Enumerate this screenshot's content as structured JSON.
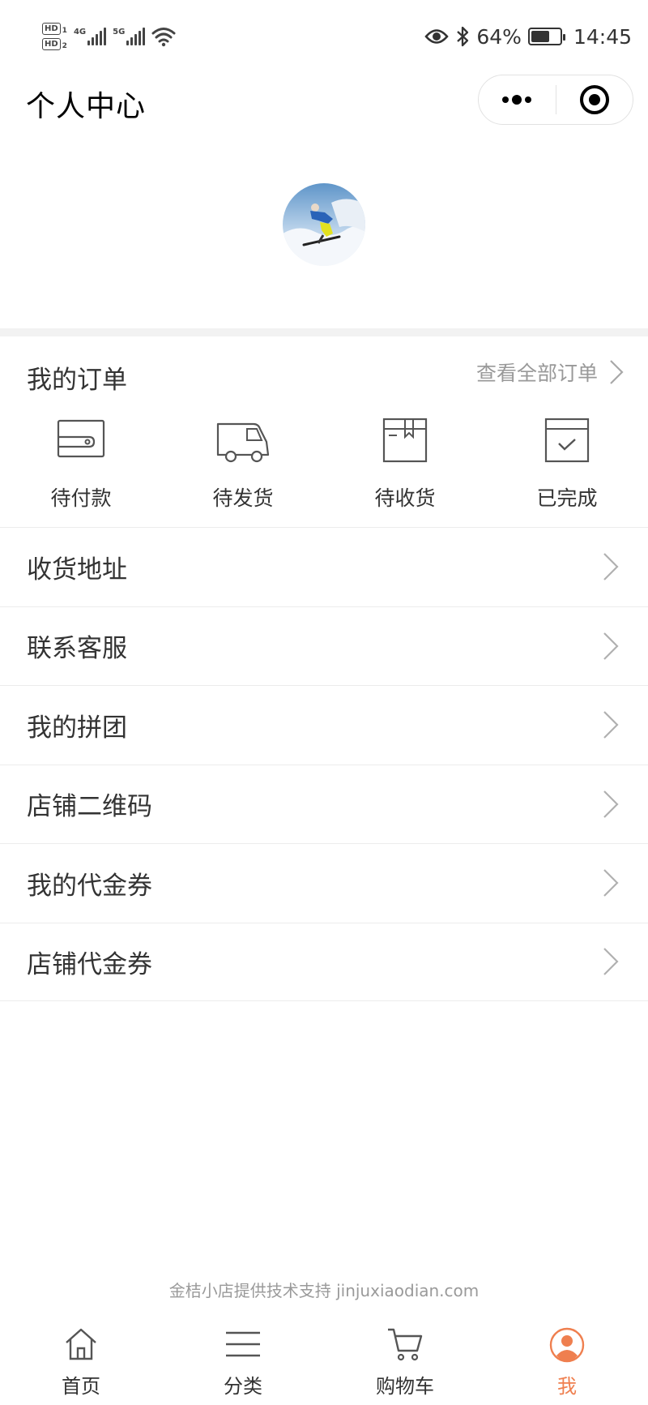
{
  "status_bar": {
    "hd1": "HD",
    "hd1_sub": "1",
    "hd2": "HD",
    "hd2_sub": "2",
    "net1": "4G",
    "net2": "5G",
    "battery_percent": "64%",
    "battery_level": 0.64,
    "time": "14:45",
    "icons": [
      "eye-icon",
      "bluetooth-icon",
      "wifi-icon",
      "battery-icon"
    ]
  },
  "nav": {
    "title": "个人中心",
    "more_icon": "more-dots-icon",
    "close_icon": "target-close-icon"
  },
  "orders": {
    "title": "我的订单",
    "view_all": "查看全部订单",
    "items": [
      {
        "label": "待付款",
        "icon": "wallet-icon"
      },
      {
        "label": "待发货",
        "icon": "truck-icon"
      },
      {
        "label": "待收货",
        "icon": "package-icon"
      },
      {
        "label": "已完成",
        "icon": "check-box-icon"
      }
    ]
  },
  "menu": {
    "items": [
      {
        "label": "收货地址"
      },
      {
        "label": "联系客服"
      },
      {
        "label": "我的拼团"
      },
      {
        "label": "店铺二维码"
      },
      {
        "label": "我的代金券"
      },
      {
        "label": "店铺代金券"
      }
    ]
  },
  "footer": {
    "note": "金桔小店提供技术支持 jinjuxiaodian.com"
  },
  "tabs": {
    "items": [
      {
        "label": "首页",
        "icon": "home-icon"
      },
      {
        "label": "分类",
        "icon": "menu-lines-icon"
      },
      {
        "label": "购物车",
        "icon": "cart-icon"
      },
      {
        "label": "我",
        "icon": "user-icon"
      }
    ],
    "active_color": "#ef7f4f"
  }
}
